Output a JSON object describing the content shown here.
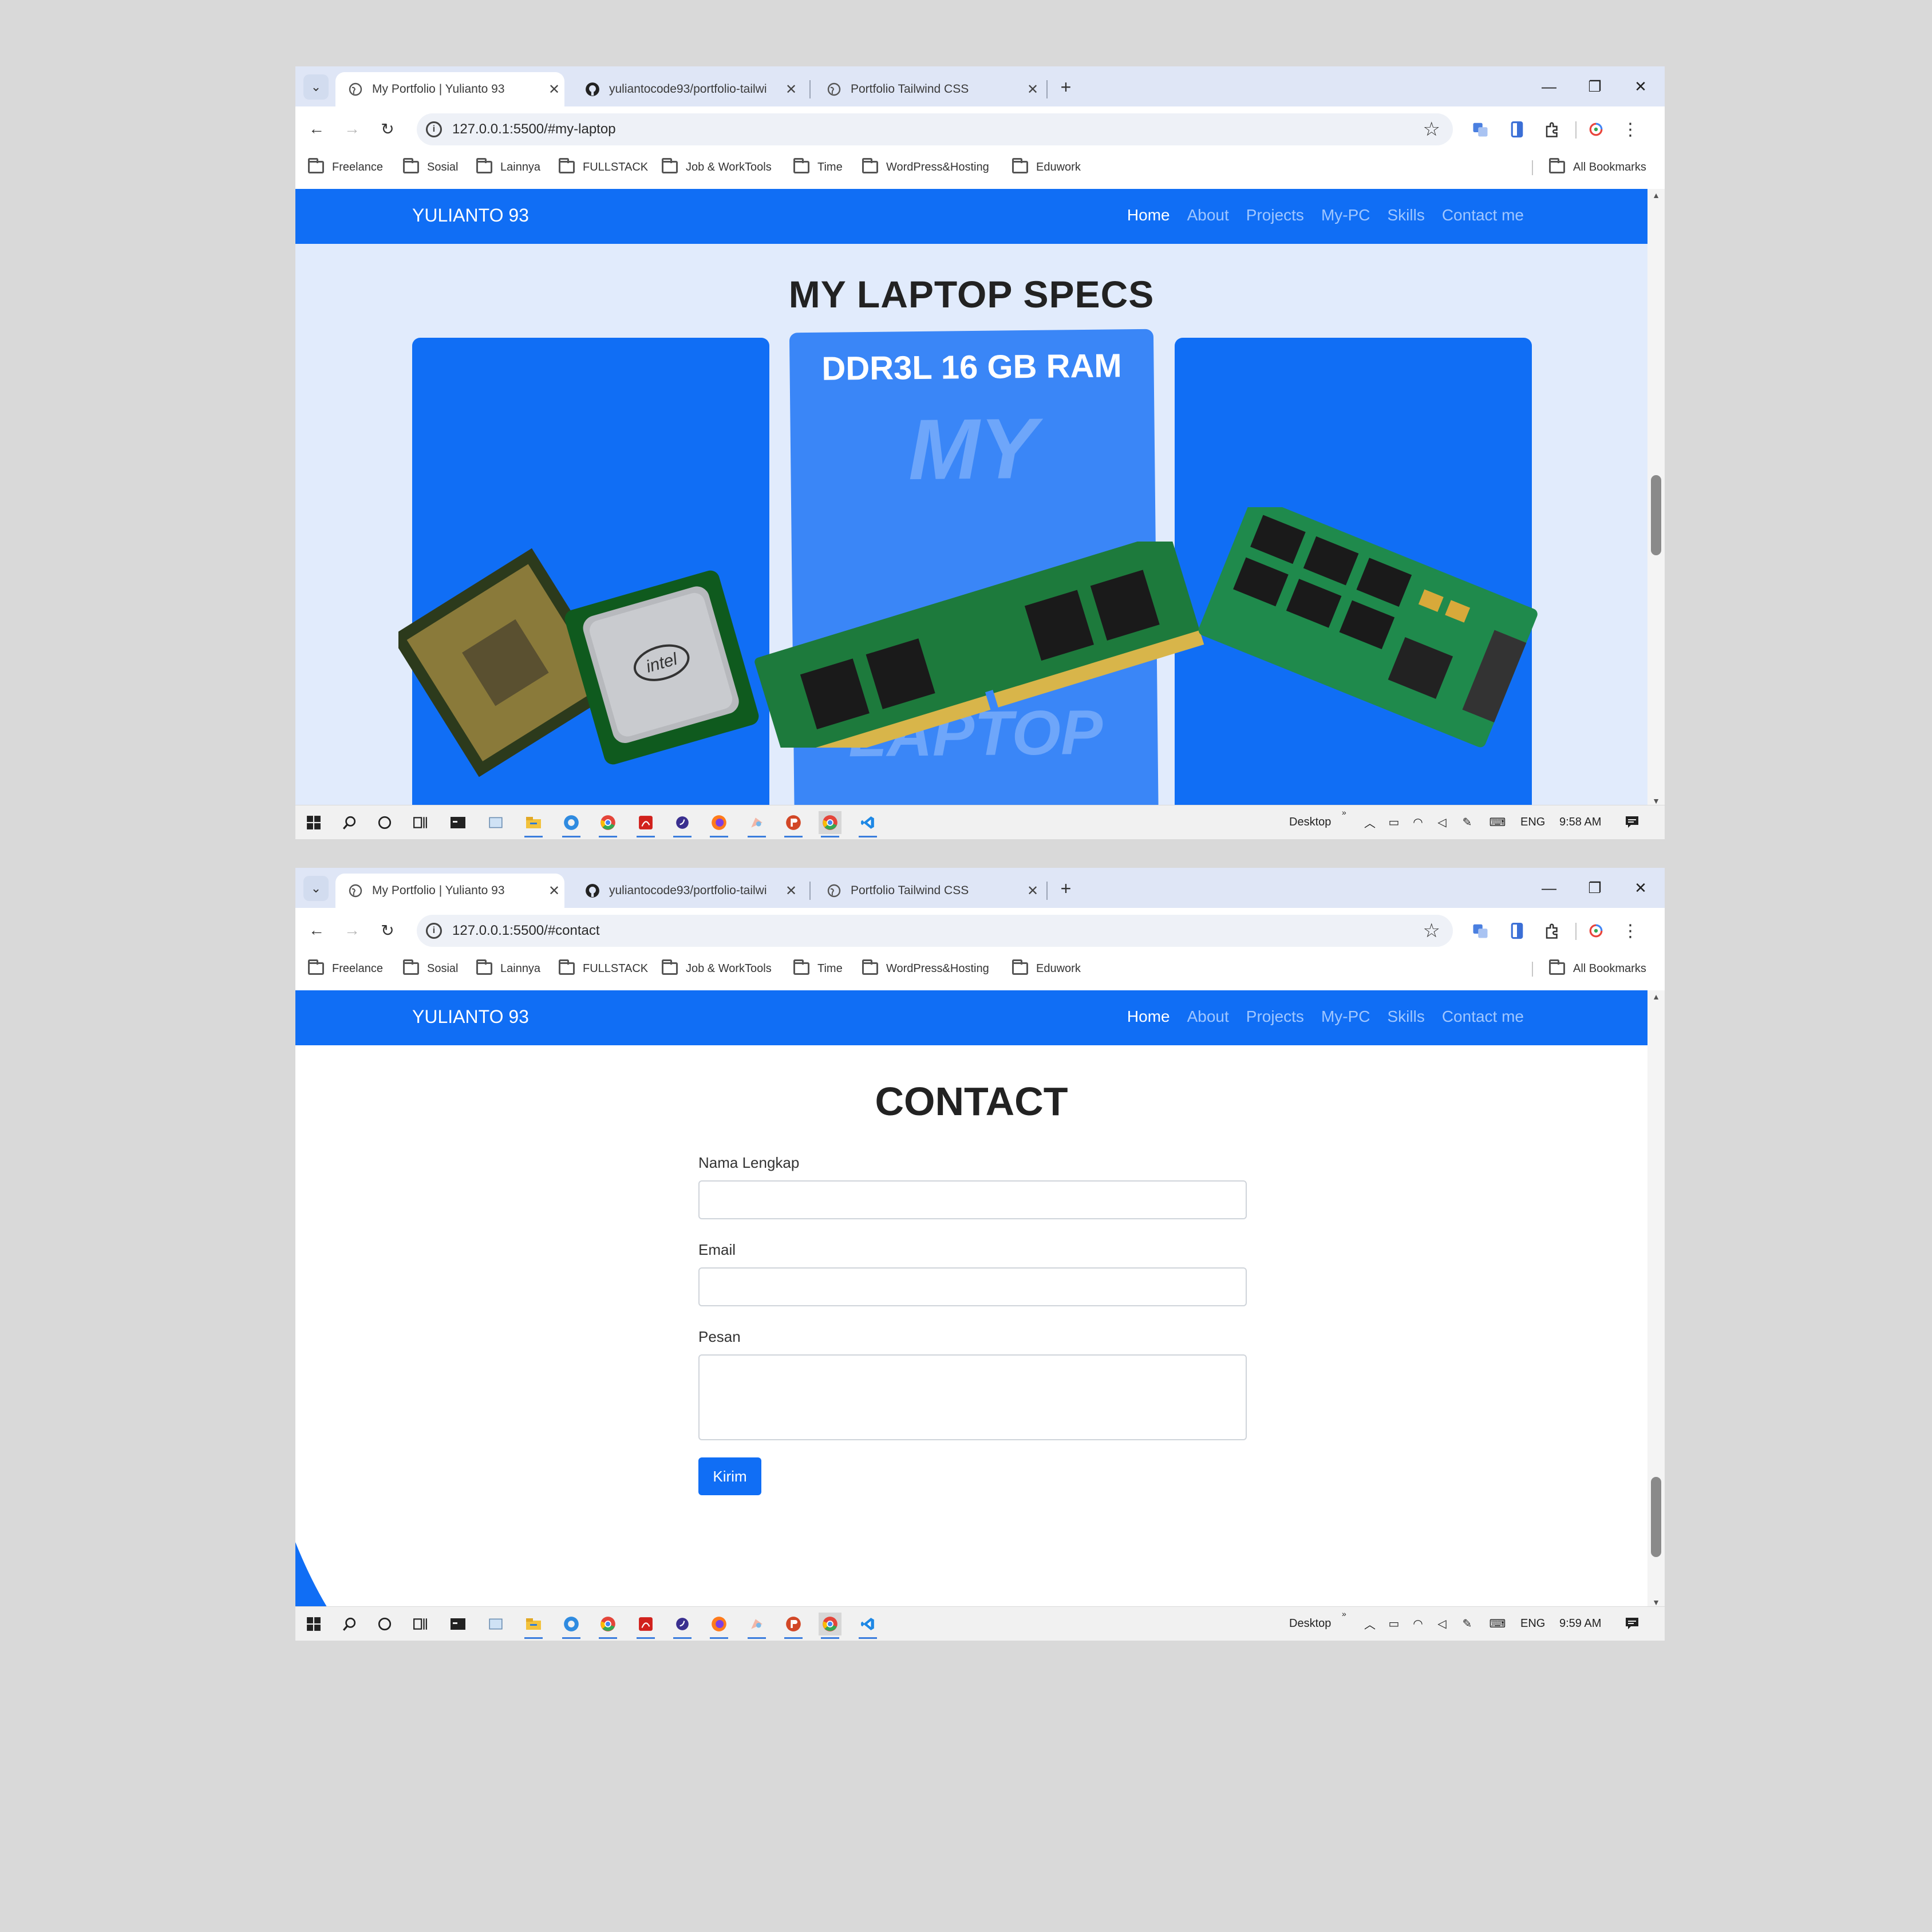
{
  "screens": [
    {
      "tabs": [
        {
          "title": "My Portfolio | Yulianto 93",
          "active": true
        },
        {
          "title": "yuliantocode93/portfolio-tailwi",
          "active": false
        },
        {
          "title": "Portfolio Tailwind CSS",
          "active": false
        }
      ],
      "url": "127.0.0.1:5500/#my-laptop",
      "clock": "9:58 AM"
    },
    {
      "tabs": [
        {
          "title": "My Portfolio | Yulianto 93",
          "active": true
        },
        {
          "title": "yuliantocode93/portfolio-tailwi",
          "active": false
        },
        {
          "title": "Portfolio Tailwind CSS",
          "active": false
        }
      ],
      "url": "127.0.0.1:5500/#contact",
      "clock": "9:59 AM"
    }
  ],
  "bookmarks": [
    "Freelance",
    "Sosial",
    "Lainnya",
    "FULLSTACK",
    "Job & WorkTools",
    "Time",
    "WordPress&Hosting",
    "Eduwork"
  ],
  "all_bookmarks": "All Bookmarks",
  "site": {
    "brand": "YULIANTO 93",
    "nav": [
      "Home",
      "About",
      "Projects",
      "My-PC",
      "Skills",
      "Contact me"
    ],
    "active_nav": "Home"
  },
  "laptop": {
    "heading": "MY LAPTOP SPECS",
    "center_card_title": "DDR3L 16 GB RAM",
    "watermark_top": "MY",
    "watermark_bottom": "LAPTOP",
    "processor_brand": "intel"
  },
  "contact": {
    "heading": "CONTACT",
    "name_label": "Nama Lengkap",
    "email_label": "Email",
    "message_label": "Pesan",
    "submit_label": "Kirim"
  },
  "taskbar": {
    "desktop_label": "Desktop",
    "language": "ENG"
  },
  "colors": {
    "site_blue": "#106ef5",
    "section_bg": "#e1ebfc",
    "tab_strip": "#dfe6f6",
    "nav_link_muted": "#9fc6ff"
  },
  "icons": [
    "tab-search-icon",
    "globe-icon",
    "github-icon",
    "close-icon",
    "plus-icon",
    "minimize-icon",
    "restore-icon",
    "back-icon",
    "forward-icon",
    "reload-icon",
    "info-icon",
    "star-icon",
    "translate-icon",
    "reading-icon",
    "extensions-icon",
    "profile-icon",
    "menu-icon",
    "folder-icon",
    "windows-icon",
    "search-icon",
    "cortana-icon",
    "taskview-icon"
  ]
}
